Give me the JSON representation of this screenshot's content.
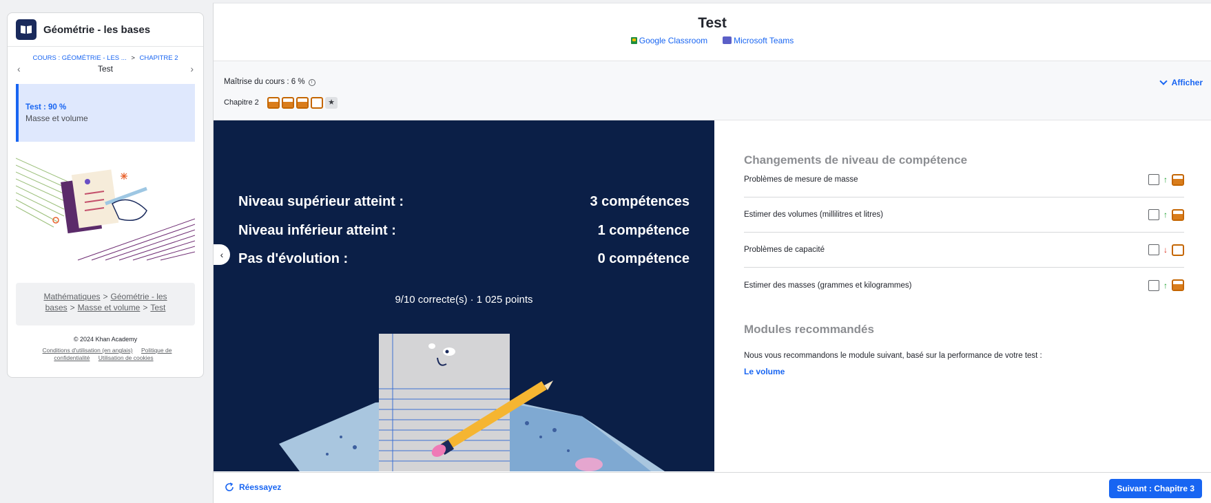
{
  "sidebar": {
    "course_title": "Géométrie - les bases",
    "breadcrumb_course": "COURS : GÉOMÉTRIE - LES ...",
    "breadcrumb_sep": ">",
    "breadcrumb_chapter": "CHAPITRE 2",
    "current": "Test",
    "active_item": {
      "score": "Test : 90 %",
      "name": "Masse et volume"
    },
    "path": [
      "Mathématiques",
      "Géométrie - les bases",
      "Masse et volume",
      "Test"
    ],
    "copyright": "© 2024 Khan Academy",
    "links": [
      "Conditions d'utilisation (en anglais)",
      "Politique de confidentialité",
      "Utilisation de cookies"
    ]
  },
  "header": {
    "title": "Test",
    "google_classroom": "Google Classroom",
    "microsoft_teams": "Microsoft Teams"
  },
  "mastery": {
    "label": "Maîtrise du cours : 6 %",
    "toggle_label": "Afficher",
    "chapter_label": "Chapitre 2"
  },
  "result": {
    "rows": [
      {
        "label": "Niveau supérieur atteint :",
        "value": "3 compétences"
      },
      {
        "label": "Niveau inférieur atteint :",
        "value": "1 compétence"
      },
      {
        "label": "Pas d'évolution :",
        "value": "0 compétence"
      }
    ],
    "score": "9/10 correcte(s) · 1 025 points"
  },
  "skills": {
    "title": "Changements de niveau de compétence",
    "items": [
      {
        "name": "Problèmes de mesure de masse",
        "direction": "up"
      },
      {
        "name": "Estimer des volumes (millilitres et litres)",
        "direction": "up"
      },
      {
        "name": "Problèmes de capacité",
        "direction": "down"
      },
      {
        "name": "Estimer des masses (grammes et kilogrammes)",
        "direction": "up"
      }
    ]
  },
  "recommended": {
    "title": "Modules recommandés",
    "text": "Nous vous recommandons le module suivant, basé sur la performance de votre test :",
    "link": "Le volume"
  },
  "footer": {
    "retry": "Réessayez",
    "next": "Suivant : Chapitre 3"
  },
  "colors": {
    "accent": "#1865f2",
    "banner": "#0b1f47",
    "mastery": "#d97d1c"
  }
}
